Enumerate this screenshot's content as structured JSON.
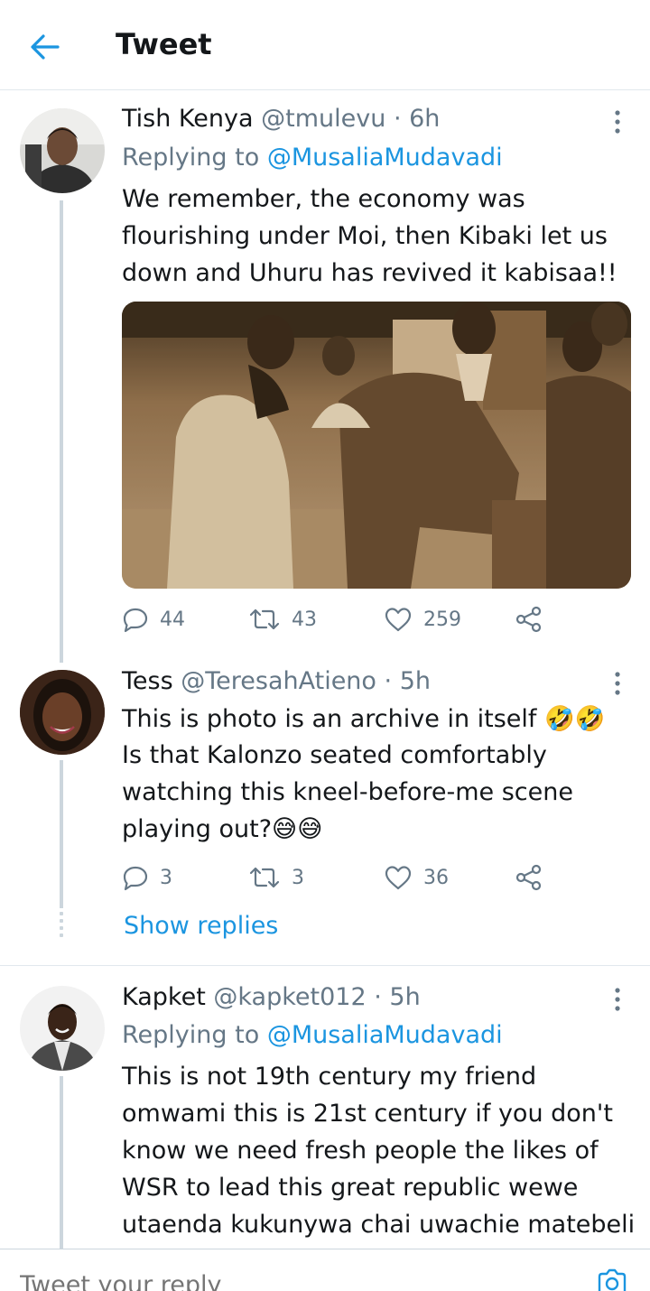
{
  "header": {
    "title": "Tweet",
    "back_icon": "back-arrow-icon",
    "accent": "#1b95e0"
  },
  "tweets": [
    {
      "name": "Tish Kenya",
      "handle": "@tmulevu",
      "time": "· 6h",
      "replying_label": "Replying to",
      "replying_to": "@MusaliaMudavadi",
      "lines": [
        "We remember, the economy was",
        "flourishing under Moi, then Kibaki let us",
        "down and Uhuru has revived it kabisaa!!"
      ],
      "media": "sepia-photo",
      "replies": "44",
      "retweets": "43",
      "likes": "259"
    },
    {
      "name": "Tess",
      "handle": "@TeresahAtieno",
      "time": "· 5h",
      "lines": [
        "This is photo is an archive in itself 🤣🤣",
        "Is that Kalonzo seated comfortably",
        "watching this kneel-before-me scene",
        "playing out?😅😅"
      ],
      "replies": "3",
      "retweets": "3",
      "likes": "36",
      "show_replies": "Show replies"
    },
    {
      "name": "Kapket",
      "handle": "@kapket012",
      "time": "· 5h",
      "replying_label": "Replying to",
      "replying_to": "@MusaliaMudavadi",
      "lines": [
        "This is not 19th century my friend",
        "omwami this is 21st century if you don't",
        "know we need fresh people the likes of",
        "WSR to lead this great republic wewe",
        "utaenda kukunywa chai uwachie matebeli"
      ]
    }
  ],
  "compose": {
    "placeholder": "Tweet your reply",
    "camera_icon": "camera-icon"
  }
}
